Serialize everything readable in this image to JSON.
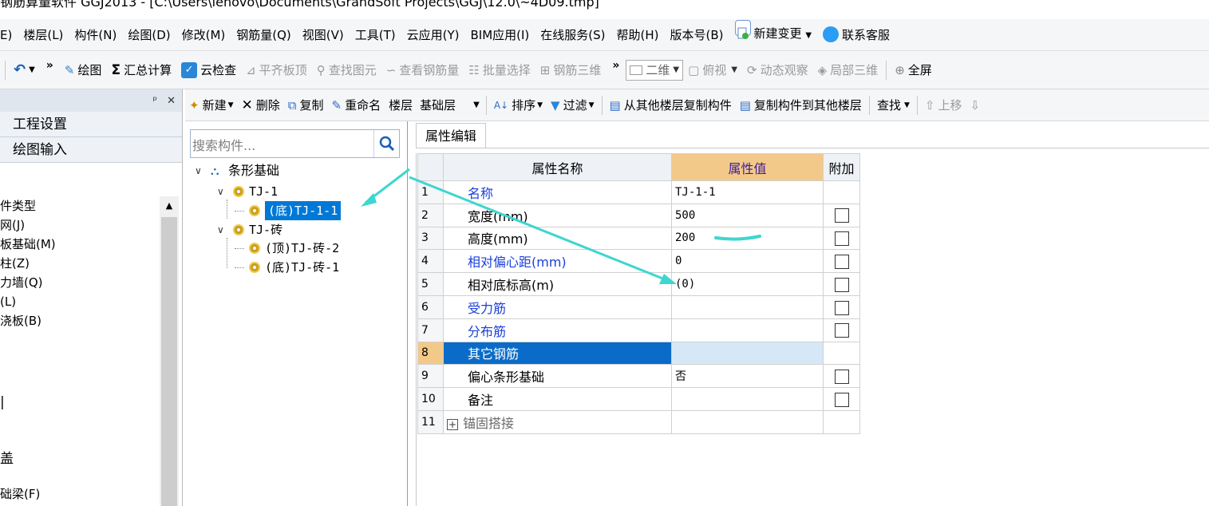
{
  "window": {
    "title": "钢筋算量软件 GGJ2013 - [C:\\Users\\lenovo\\Documents\\GrandSoft Projects\\GGJ\\12.0\\~4D09.tmp]"
  },
  "menu": {
    "items": [
      "E)",
      "楼层(L)",
      "构件(N)",
      "绘图(D)",
      "修改(M)",
      "钢筋量(Q)",
      "视图(V)",
      "工具(T)",
      "云应用(Y)",
      "BIM应用(I)",
      "在线服务(S)",
      "帮助(H)",
      "版本号(B)"
    ],
    "new_change": "新建变更",
    "contact": "联系客服"
  },
  "toolbar": {
    "draw": "绘图",
    "sum": "汇总计算",
    "cloud_check": "云检查",
    "align_slab_top": "平齐板顶",
    "find_element": "查找图元",
    "view_rebar": "查看钢筋量",
    "batch_select": "批量选择",
    "rebar_3d": "钢筋三维",
    "view_mode": "二维",
    "top_view": "俯视",
    "dynamic_view": "动态观察",
    "local_3d": "局部三维",
    "fullscreen": "全屏"
  },
  "left_panel": {
    "nav": [
      "工程设置",
      "绘图输入"
    ],
    "list": [
      "件类型",
      "网(J)",
      "板基础(M)",
      "柱(Z)",
      "力墙(Q)",
      "(L)",
      "浇板(B)"
    ],
    "extra1": "盖",
    "extra2": "础梁(F)"
  },
  "component_toolbar": {
    "new": "新建",
    "delete": "删除",
    "copy": "复制",
    "rename": "重命名",
    "floor_label": "楼层",
    "floor_value": "基础层",
    "sort": "排序",
    "filter": "过滤",
    "copy_from_other": "从其他楼层复制构件",
    "copy_to_other": "复制构件到其他楼层",
    "find": "查找",
    "move_up": "上移"
  },
  "tree": {
    "search_placeholder": "搜索构件...",
    "root": "条形基础",
    "n1": "TJ-1",
    "n1_child": "(底)TJ-1-1",
    "n2": "TJ-砖",
    "n2_child1": "(顶)TJ-砖-2",
    "n2_child2": "(底)TJ-砖-1"
  },
  "properties": {
    "tab": "属性编辑",
    "headers": {
      "name": "属性名称",
      "value": "属性值",
      "extra": "附加"
    },
    "rows": [
      {
        "num": "1",
        "name": "名称",
        "value": "TJ-1-1"
      },
      {
        "num": "2",
        "name": "宽度(mm)",
        "value": "500"
      },
      {
        "num": "3",
        "name": "高度(mm)",
        "value": "200"
      },
      {
        "num": "4",
        "name": "相对偏心距(mm)",
        "value": "0"
      },
      {
        "num": "5",
        "name": "相对底标高(m)",
        "value": "(0)"
      },
      {
        "num": "6",
        "name": "受力筋",
        "value": ""
      },
      {
        "num": "7",
        "name": "分布筋",
        "value": ""
      },
      {
        "num": "8",
        "name": "其它钢筋",
        "value": ""
      },
      {
        "num": "9",
        "name": "偏心条形基础",
        "value": "否"
      },
      {
        "num": "10",
        "name": "备注",
        "value": ""
      },
      {
        "num": "11",
        "name": "锚固搭接",
        "value": ""
      }
    ]
  },
  "colors": {
    "accent_blue": "#0078d7",
    "annotation_cyan": "#3dd6d0",
    "header_orange": "#f3c98a"
  }
}
